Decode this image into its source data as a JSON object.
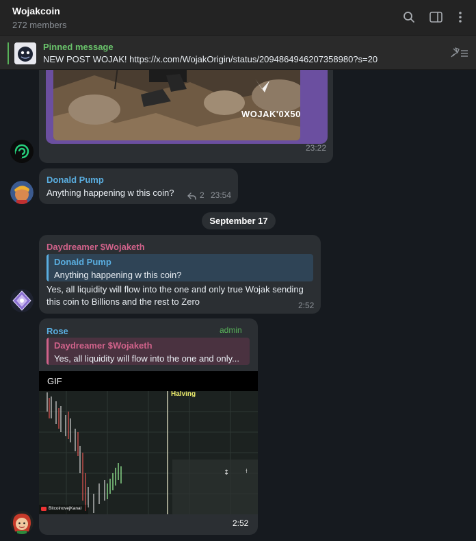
{
  "header": {
    "title": "Wojakcoin",
    "members": "272 members",
    "icons": [
      "search-icon",
      "sidebar-toggle-icon",
      "more-vertical-icon"
    ]
  },
  "pinned": {
    "label": "Pinned message",
    "text": "NEW POST WOJAK!  https://x.com/WojakOrigin/status/2094864946207358980?s=20"
  },
  "messages": [
    {
      "image_caption": "WOJAK'0X50",
      "time": "23:22"
    },
    {
      "sender": "Donald Pump",
      "text": "Anything happening w this coin?",
      "replies": "2",
      "time": "23:54"
    },
    {
      "sender": "Daydreamer $Wojaketh",
      "reply_to": {
        "name": "Donald Pump",
        "text": "Anything happening w this coin?"
      },
      "text_line1": "Yes, all liquidity will flow into the one and only true Wojak sending",
      "text_line2": "this coin to Billions and the rest to Zero",
      "time": "2:52"
    },
    {
      "sender": "Rose",
      "badge": "admin",
      "reply_to": {
        "name": "Daydreamer $Wojaketh",
        "text": "Yes, all liquidity will flow into the one and only..."
      },
      "gif_label": "GIF",
      "gif_annotation": "Halving",
      "gif_watermark": "BitcoinovejKanal",
      "time": "2:52"
    }
  ],
  "date_separator": "September 17",
  "colors": {
    "accent_green": "#6ac36b",
    "name_blue": "#5aaee0",
    "name_pink": "#d0628a",
    "bubble": "#2b2f33",
    "background": "#161a1f"
  }
}
